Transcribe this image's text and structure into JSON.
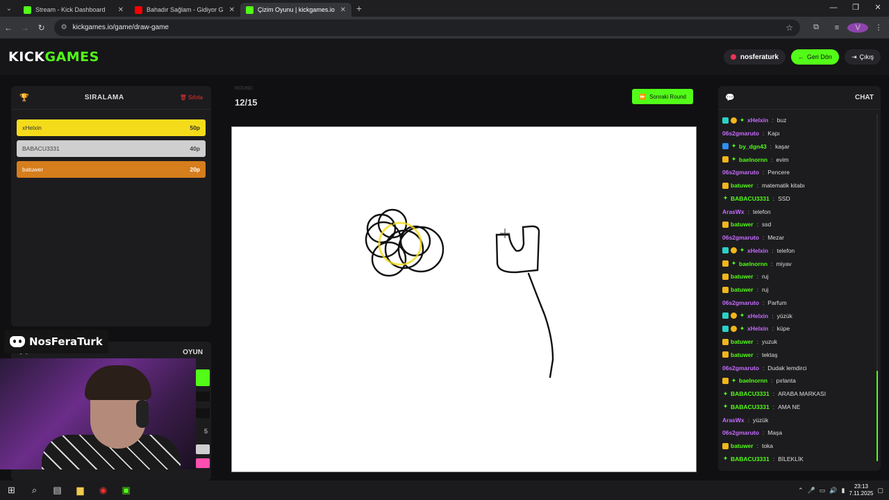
{
  "browser": {
    "tabs": [
      {
        "title": "Stream - Kick Dashboard",
        "color": "#53fc18",
        "active": false
      },
      {
        "title": "Bahadır Sağlam - Gidiyor G",
        "color": "#ff0000",
        "active": false
      },
      {
        "title": "Çizim Oyunu | kickgames.io",
        "color": "#53fc18",
        "active": true
      }
    ],
    "url": "kickgames.io/game/draw-game",
    "profile_letter": "V"
  },
  "header": {
    "logo_kick": "KICK",
    "logo_games": "GAMES",
    "username": "nosferaturk",
    "back_label": "Geri Dön",
    "logout_label": "Çıkış"
  },
  "leaderboard": {
    "title": "SIRALAMA",
    "reset_label": "Sıfırla",
    "players": [
      {
        "name": "xHelxin",
        "points": "50p"
      },
      {
        "name": "BABACU3331",
        "points": "40p"
      },
      {
        "name": "batuwer",
        "points": "20p"
      }
    ]
  },
  "game_panel": {
    "title": "OYUN",
    "brush_size": "5"
  },
  "streamer": {
    "discord_name": "NosFeraTurk"
  },
  "round": {
    "label": "ROUND",
    "value": "12/15",
    "next_label": "Sonraki Round"
  },
  "chat": {
    "title": "CHAT",
    "messages": [
      {
        "user": "xHelxin",
        "color": "#c86bff",
        "badges": [
          "teal",
          "gold",
          "green"
        ],
        "text": "buz"
      },
      {
        "user": "06s2gmaruto",
        "color": "#c86bff",
        "badges": [],
        "text": "Kapı"
      },
      {
        "user": "by_dgn43",
        "color": "#53fc18",
        "badges": [
          "blue",
          "green"
        ],
        "text": "kaşar"
      },
      {
        "user": "baelnornn",
        "color": "#53fc18",
        "badges": [
          "crown",
          "green"
        ],
        "text": "evim"
      },
      {
        "user": "06s2gmaruto",
        "color": "#c86bff",
        "badges": [],
        "text": "Pencere"
      },
      {
        "user": "batuwer",
        "color": "#53fc18",
        "badges": [
          "crown"
        ],
        "text": "matematik kitabı"
      },
      {
        "user": "BABACU3331",
        "color": "#53fc18",
        "badges": [
          "green"
        ],
        "text": "SSD"
      },
      {
        "user": "ArasWx",
        "color": "#c86bff",
        "badges": [],
        "text": "telefon"
      },
      {
        "user": "batuwer",
        "color": "#53fc18",
        "badges": [
          "crown"
        ],
        "text": "ssd"
      },
      {
        "user": "06s2gmaruto",
        "color": "#c86bff",
        "badges": [],
        "text": "Mezar"
      },
      {
        "user": "xHelxin",
        "color": "#c86bff",
        "badges": [
          "teal",
          "gold",
          "green"
        ],
        "text": "telefon"
      },
      {
        "user": "baelnornn",
        "color": "#53fc18",
        "badges": [
          "crown",
          "green"
        ],
        "text": "miyav"
      },
      {
        "user": "batuwer",
        "color": "#53fc18",
        "badges": [
          "crown"
        ],
        "text": "ruj"
      },
      {
        "user": "batuwer",
        "color": "#53fc18",
        "badges": [
          "crown"
        ],
        "text": "ruj"
      },
      {
        "user": "06s2gmaruto",
        "color": "#c86bff",
        "badges": [],
        "text": "Parfum"
      },
      {
        "user": "xHelxin",
        "color": "#c86bff",
        "badges": [
          "teal",
          "gold",
          "green"
        ],
        "text": "yüzük"
      },
      {
        "user": "xHelxin",
        "color": "#c86bff",
        "badges": [
          "teal",
          "gold",
          "green"
        ],
        "text": "küpe"
      },
      {
        "user": "batuwer",
        "color": "#53fc18",
        "badges": [
          "crown"
        ],
        "text": "yuzuk"
      },
      {
        "user": "batuwer",
        "color": "#53fc18",
        "badges": [
          "crown"
        ],
        "text": "tektaş"
      },
      {
        "user": "06s2gmaruto",
        "color": "#c86bff",
        "badges": [],
        "text": "Dudak lemdirci"
      },
      {
        "user": "baelnornn",
        "color": "#53fc18",
        "badges": [
          "crown",
          "green"
        ],
        "text": "pırlanta"
      },
      {
        "user": "BABACU3331",
        "color": "#53fc18",
        "badges": [
          "green"
        ],
        "text": "ARABA MARKASI"
      },
      {
        "user": "BABACU3331",
        "color": "#53fc18",
        "badges": [
          "green"
        ],
        "text": "AMA NE"
      },
      {
        "user": "ArasWx",
        "color": "#c86bff",
        "badges": [],
        "text": "yüzük"
      },
      {
        "user": "06s2gmaruto",
        "color": "#c86bff",
        "badges": [],
        "text": "Maşa"
      },
      {
        "user": "batuwer",
        "color": "#53fc18",
        "badges": [
          "crown"
        ],
        "text": "toka"
      },
      {
        "user": "BABACU3331",
        "color": "#53fc18",
        "badges": [
          "green"
        ],
        "text": "BİLEKLİK"
      }
    ]
  },
  "taskbar": {
    "time": "23:13",
    "date": "7.11.2025"
  },
  "colors": {
    "accent": "#53fc18",
    "gold": "#f5dc1b",
    "silver": "#cfcfcf",
    "bronze": "#d67d1c"
  }
}
